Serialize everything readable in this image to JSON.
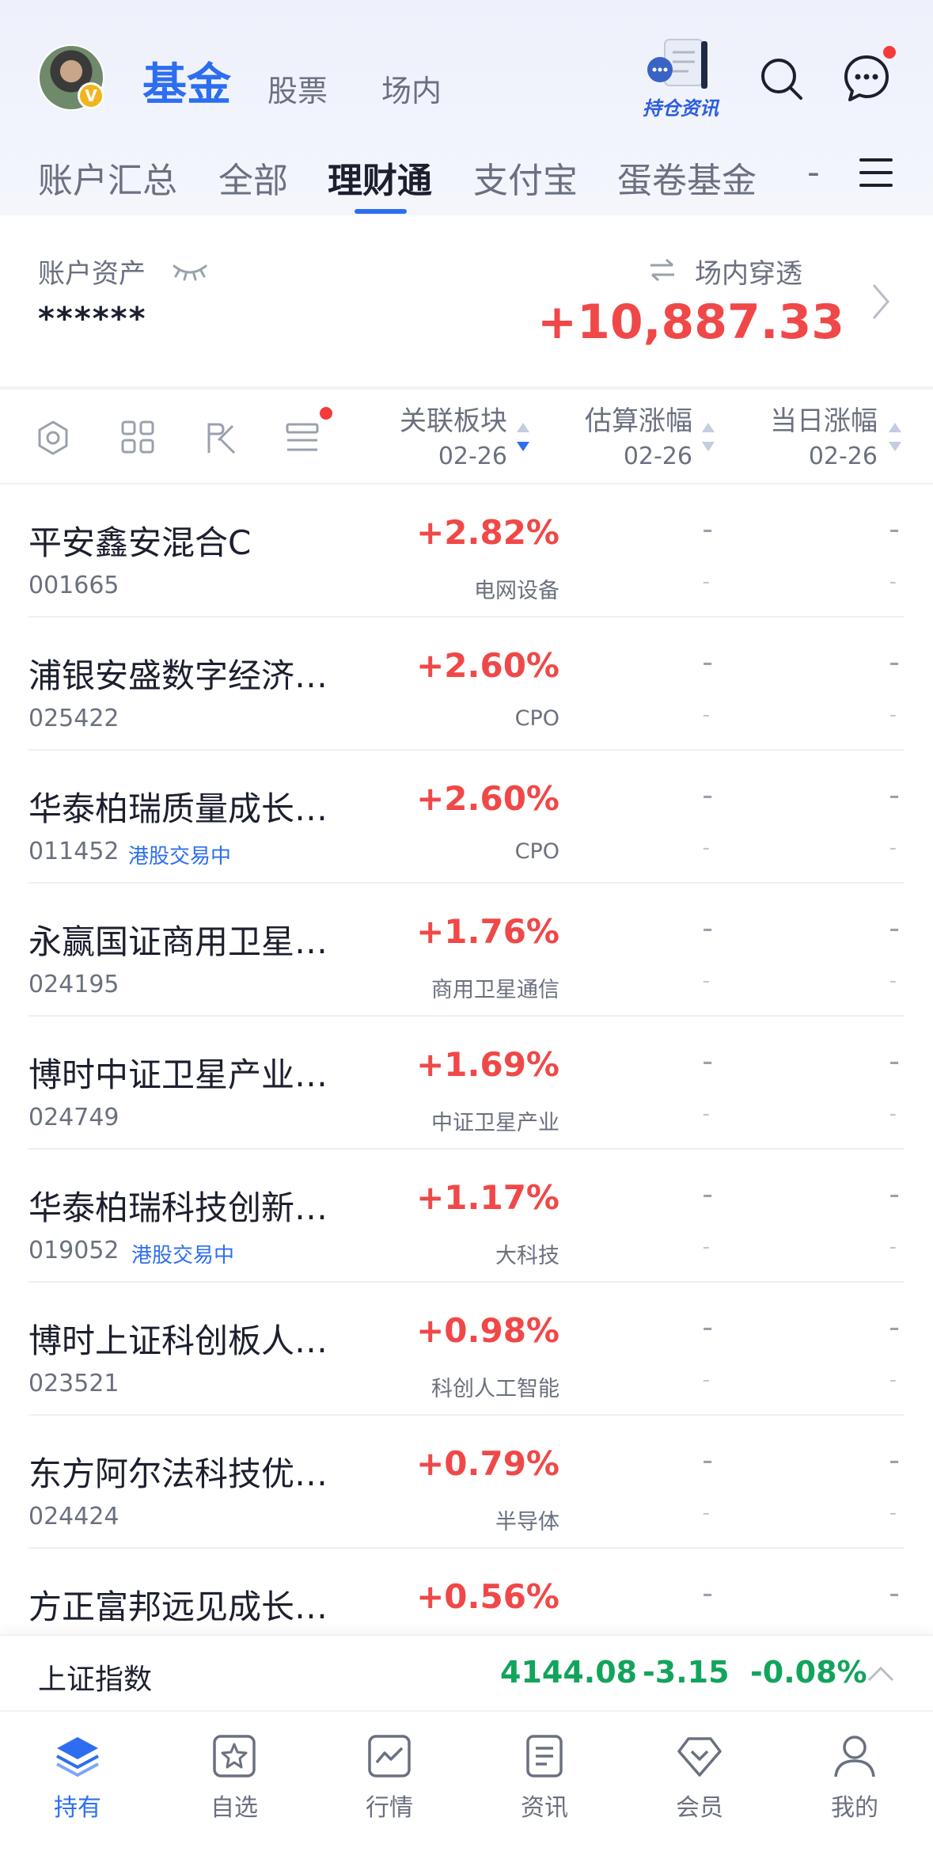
{
  "header": {
    "avatar_badge": "V",
    "tabs": [
      {
        "label": "基金",
        "active": true
      },
      {
        "label": "股票",
        "active": false
      },
      {
        "label": "场内",
        "active": false
      }
    ],
    "holding_news_label": "持仓资讯",
    "icons": [
      "search-icon",
      "message-icon"
    ]
  },
  "subtabs": [
    {
      "label": "账户汇总"
    },
    {
      "label": "全部"
    },
    {
      "label": "理财通",
      "active": true
    },
    {
      "label": "支付宝"
    },
    {
      "label": "蛋卷基金"
    },
    {
      "label": "-"
    }
  ],
  "account": {
    "asset_label": "账户资产",
    "asset_value": "******",
    "penetrate_label": "场内穿透",
    "penetrate_value": "+10,887.33"
  },
  "columns": {
    "sector": {
      "title": "关联板块",
      "date": "02-26"
    },
    "estimate": {
      "title": "估算涨幅",
      "date": "02-26"
    },
    "daily": {
      "title": "当日涨幅",
      "date": "02-26"
    }
  },
  "funds": [
    {
      "name": "平安鑫安混合C",
      "code": "001665",
      "tag": "",
      "pct": "+2.82%",
      "sector": "电网设备",
      "est": "-",
      "est_sub": "-",
      "day": "-",
      "day_sub": "-"
    },
    {
      "name": "浦银安盛数字经济…",
      "code": "025422",
      "tag": "",
      "pct": "+2.60%",
      "sector": "CPO",
      "est": "-",
      "est_sub": "-",
      "day": "-",
      "day_sub": "-"
    },
    {
      "name": "华泰柏瑞质量成长…",
      "code": "011452",
      "tag": "港股交易中",
      "pct": "+2.60%",
      "sector": "CPO",
      "est": "-",
      "est_sub": "-",
      "day": "-",
      "day_sub": "-"
    },
    {
      "name": "永赢国证商用卫星…",
      "code": "024195",
      "tag": "",
      "pct": "+1.76%",
      "sector": "商用卫星通信",
      "est": "-",
      "est_sub": "-",
      "day": "-",
      "day_sub": "-"
    },
    {
      "name": "博时中证卫星产业…",
      "code": "024749",
      "tag": "",
      "pct": "+1.69%",
      "sector": "中证卫星产业",
      "est": "-",
      "est_sub": "-",
      "day": "-",
      "day_sub": "-"
    },
    {
      "name": "华泰柏瑞科技创新…",
      "code": "019052",
      "tag": "港股交易中",
      "pct": "+1.17%",
      "sector": "大科技",
      "est": "-",
      "est_sub": "-",
      "day": "-",
      "day_sub": "-"
    },
    {
      "name": "博时上证科创板人…",
      "code": "023521",
      "tag": "",
      "pct": "+0.98%",
      "sector": "科创人工智能",
      "est": "-",
      "est_sub": "-",
      "day": "-",
      "day_sub": "-"
    },
    {
      "name": "东方阿尔法科技优…",
      "code": "024424",
      "tag": "",
      "pct": "+0.79%",
      "sector": "半导体",
      "est": "-",
      "est_sub": "-",
      "day": "-",
      "day_sub": "-"
    },
    {
      "name": "方正富邦远见成长…",
      "code": "",
      "tag": "",
      "pct": "+0.56%",
      "sector": "",
      "est": "-",
      "est_sub": "",
      "day": "-",
      "day_sub": ""
    }
  ],
  "index": {
    "name": "上证指数",
    "value": "4144.08",
    "change": "-3.15",
    "change_pct": "-0.08%"
  },
  "nav": [
    {
      "label": "持有",
      "icon": "layers-icon",
      "active": true
    },
    {
      "label": "自选",
      "icon": "star-icon"
    },
    {
      "label": "行情",
      "icon": "chart-icon"
    },
    {
      "label": "资讯",
      "icon": "document-icon"
    },
    {
      "label": "会员",
      "icon": "member-icon"
    },
    {
      "label": "我的",
      "icon": "person-icon"
    }
  ],
  "colors": {
    "accent": "#2d6ef0",
    "up": "#f04848",
    "down": "#13a45c"
  }
}
